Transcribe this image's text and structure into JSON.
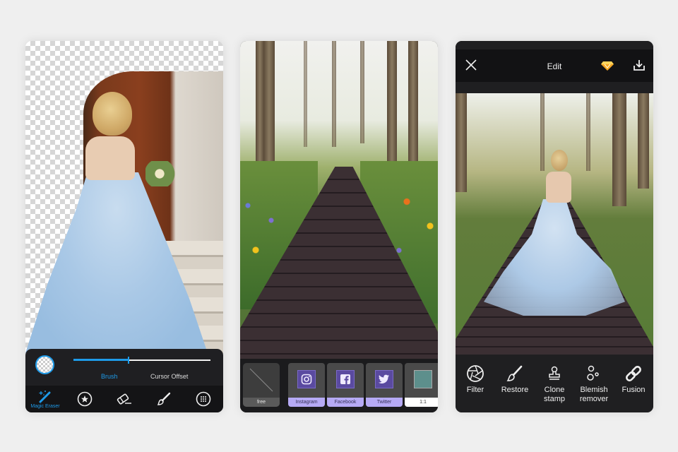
{
  "theme": {
    "accent": "#1e9be9",
    "share_label_bg": "#b6aaf5",
    "share_icon_bg": "#5a4aa0",
    "diamond": "#f5a623"
  },
  "screen1": {
    "brush_slider": {
      "value_percent": 40
    },
    "tabs": [
      {
        "label": "Brush",
        "active": true
      },
      {
        "label": "Cursor Offset",
        "active": false
      }
    ],
    "tools": [
      {
        "icon": "magic-wand-icon",
        "label": "Magic Eraser",
        "active": true
      },
      {
        "icon": "star-circle-icon",
        "label": ""
      },
      {
        "icon": "eraser-icon",
        "label": ""
      },
      {
        "icon": "brush-icon",
        "label": ""
      },
      {
        "icon": "grid-circle-icon",
        "label": ""
      }
    ]
  },
  "screen2": {
    "formats": [
      {
        "label": "free",
        "icon": "free-crop-icon"
      },
      {
        "label": "Instagram",
        "icon": "instagram-icon"
      },
      {
        "label": "Facebook",
        "icon": "facebook-icon"
      },
      {
        "label": "Twitter",
        "icon": "twitter-icon"
      },
      {
        "label": "1:1",
        "icon": "square-ratio-icon"
      }
    ]
  },
  "screen3": {
    "header": {
      "title": "Edit",
      "close_icon": "close-icon",
      "premium_icon": "diamond-icon",
      "export_icon": "download-icon"
    },
    "tools": [
      {
        "label": "Filter",
        "icon": "aperture-icon"
      },
      {
        "label": "Restore",
        "icon": "brush-icon"
      },
      {
        "label": "Clone\nstamp",
        "line1": "Clone",
        "line2": "stamp",
        "icon": "stamp-icon"
      },
      {
        "label": "Blemish\nremover",
        "line1": "Blemish",
        "line2": "remover",
        "icon": "bubbles-icon"
      },
      {
        "label": "Fusion",
        "icon": "link-icon"
      }
    ]
  }
}
